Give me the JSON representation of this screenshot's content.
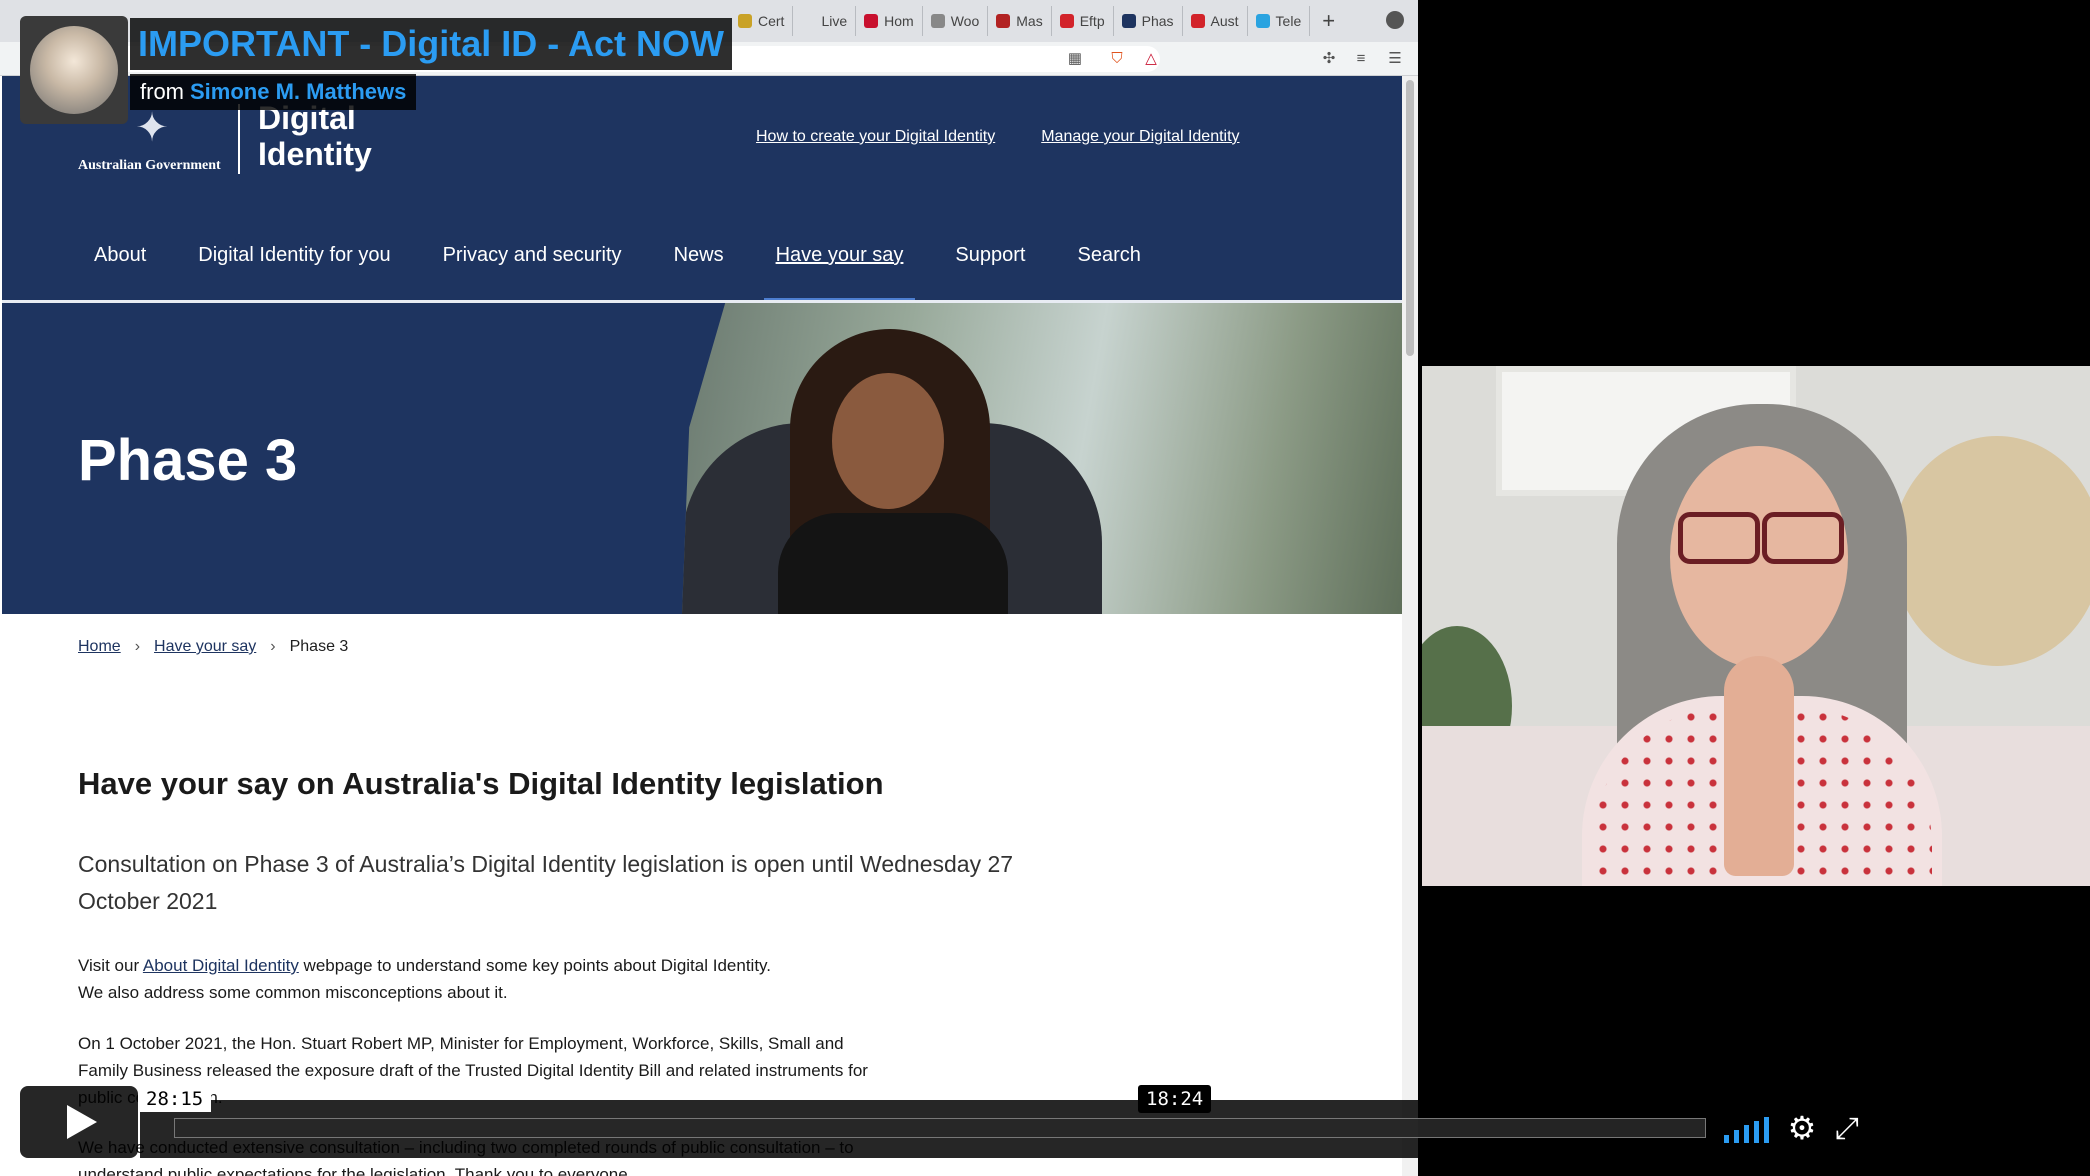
{
  "video": {
    "title": "IMPORTANT - Digital ID - Act NOW",
    "byline_prefix": "from",
    "author": "Simone M. Matthews",
    "current_time": "28:15",
    "hover_time": "18:24",
    "progress_fraction": 0.0,
    "accent_color": "#2b9cf2"
  },
  "browser": {
    "tabs": [
      {
        "label": "Cert",
        "favicon_color": "#c9a227"
      },
      {
        "label": "Live",
        "favicon_color": "#dfe1e5"
      },
      {
        "label": "Hom",
        "favicon_color": "#c8102e"
      },
      {
        "label": "Woo",
        "favicon_color": "#888888"
      },
      {
        "label": "Mas",
        "favicon_color": "#b22222"
      },
      {
        "label": "Eftp",
        "favicon_color": "#d2232a"
      },
      {
        "label": "Phas",
        "favicon_color": "#1e3460"
      },
      {
        "label": "Aust",
        "favicon_color": "#d2232a"
      },
      {
        "label": "Tele",
        "favicon_color": "#2aa3e0"
      }
    ],
    "new_tab_label": "+"
  },
  "site": {
    "gov_name": "Australian Government",
    "brand_name": "Digital Identity",
    "top_links": [
      "How to create your Digital Identity",
      "Manage your Digital Identity"
    ],
    "nav": [
      "About",
      "Digital Identity for you",
      "Privacy and security",
      "News",
      "Have your say",
      "Support",
      "Search"
    ],
    "nav_active": "Have your say",
    "hero_title": "Phase 3",
    "breadcrumb": {
      "home": "Home",
      "section": "Have your say",
      "current": "Phase 3",
      "separator": "›"
    },
    "heading": "Have your say on Australia's Digital Identity legislation",
    "lead": "Consultation on Phase 3 of Australia’s Digital Identity legislation is open until Wednesday 27 October 2021",
    "para1_before": "Visit our ",
    "para1_link": "About Digital Identity",
    "para1_after": " webpage to understand some key points about Digital Identity.",
    "para1_line2": "We also address some common misconceptions about it.",
    "para2": "On 1 October 2021, the Hon. Stuart Robert MP, Minister for Employment, Workforce, Skills, Small and Family Business released the exposure draft of the Trusted Digital Identity Bill and related instruments for public consultation.",
    "para3": "We have conducted extensive consultation – including two completed rounds of public consultation – to understand public expectations for the legislation. Thank you to everyone"
  }
}
